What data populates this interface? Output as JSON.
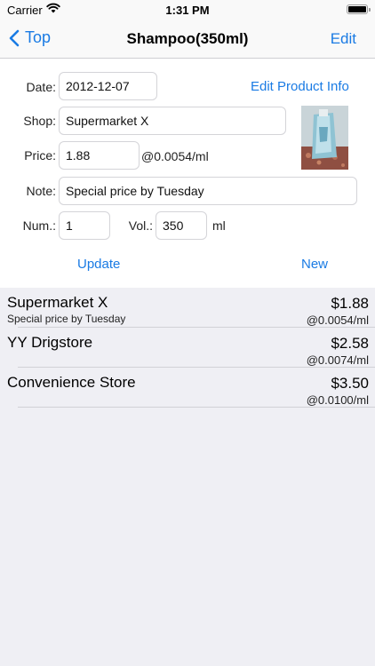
{
  "status_bar": {
    "carrier": "Carrier",
    "time": "1:31 PM"
  },
  "nav": {
    "back_label": "Top",
    "title": "Shampoo(350ml)",
    "edit_label": "Edit"
  },
  "form": {
    "date_label": "Date:",
    "date_value": "2012-12-07",
    "edit_product_info": "Edit Product Info",
    "shop_label": "Shop:",
    "shop_value": "Supermarket X",
    "price_label": "Price:",
    "price_value": "1.88",
    "unit_price": "@0.0054/ml",
    "note_label": "Note:",
    "note_value": "Special price by Tuesday",
    "num_label": "Num.:",
    "num_value": "1",
    "vol_label": "Vol.:",
    "vol_value": "350",
    "vol_unit": "ml",
    "update_label": "Update",
    "new_label": "New"
  },
  "entries": [
    {
      "shop": "Supermarket X",
      "note": "Special price by Tuesday",
      "price": "$1.88",
      "unit_price": "@0.0054/ml"
    },
    {
      "shop": "YY Drigstore",
      "note": "",
      "price": "$2.58",
      "unit_price": "@0.0074/ml"
    },
    {
      "shop": "Convenience Store",
      "note": "",
      "price": "$3.50",
      "unit_price": "@0.0100/ml"
    }
  ],
  "colors": {
    "accent": "#1a7be4",
    "background": "#efeff4"
  },
  "icons": {
    "back": "chevron-left-icon",
    "wifi": "wifi-icon",
    "battery": "battery-icon",
    "product": "product-photo"
  }
}
